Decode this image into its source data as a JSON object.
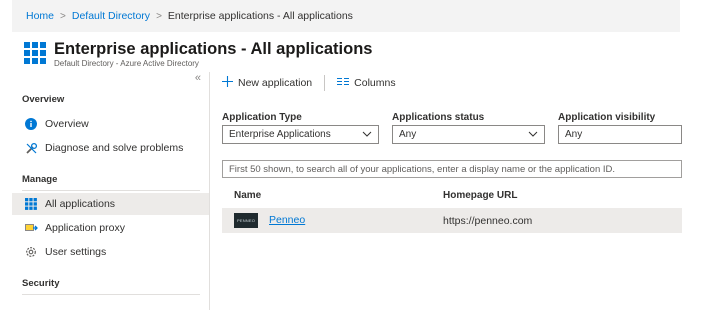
{
  "breadcrumb": [
    "Home",
    "Default Directory",
    "Enterprise applications - All applications"
  ],
  "header": {
    "title": "Enterprise applications - All applications",
    "subtitle": "Default Directory - Azure Active Directory"
  },
  "sidebar": {
    "collapse_glyph": "«",
    "sections": {
      "overview": "Overview",
      "manage": "Manage",
      "security": "Security"
    },
    "items": [
      {
        "label": "Overview",
        "icon": "info-icon"
      },
      {
        "label": "Diagnose and solve problems",
        "icon": "wrench-icon"
      },
      {
        "label": "All applications",
        "icon": "grid-icon",
        "active": true
      },
      {
        "label": "Application proxy",
        "icon": "proxy-icon"
      },
      {
        "label": "User settings",
        "icon": "gear-icon"
      }
    ]
  },
  "toolbar": {
    "new_application": "New application",
    "columns": "Columns"
  },
  "filters": {
    "application_type": {
      "label": "Application Type",
      "value": "Enterprise Applications"
    },
    "application_status": {
      "label": "Applications status",
      "value": "Any"
    },
    "application_visibility": {
      "label": "Application visibility",
      "value": "Any"
    }
  },
  "search": {
    "placeholder": "First 50 shown, to search all of your applications, enter a display name or the application ID."
  },
  "table": {
    "columns": [
      "Name",
      "Homepage URL"
    ],
    "rows": [
      {
        "name": "Penneo",
        "homepage": "https://penneo.com",
        "logo_text": "PENNEO"
      }
    ]
  },
  "colors": {
    "accent": "#0078d4",
    "selected_row": "#edebe9",
    "text": "#323130"
  }
}
